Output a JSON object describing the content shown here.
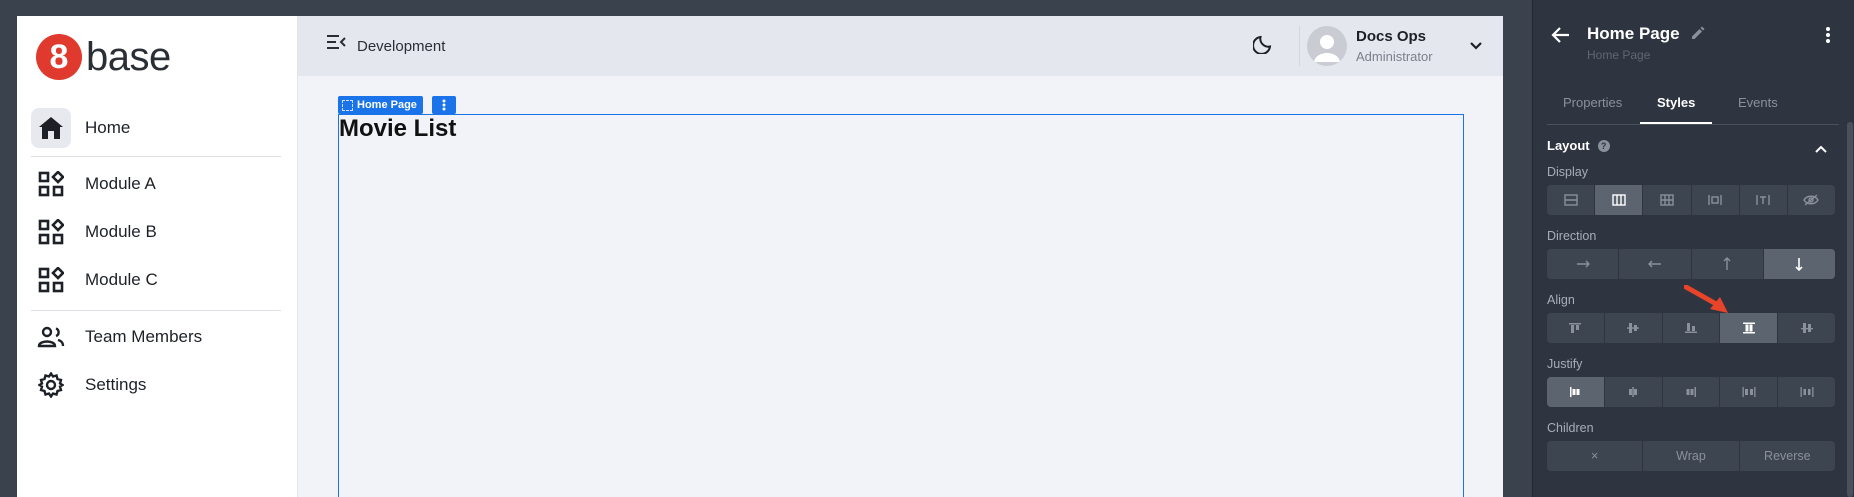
{
  "sidebar": {
    "logo": {
      "mark": "8",
      "text": "base",
      "brand_color": "#e03a2f"
    },
    "items": [
      {
        "label": "Home",
        "icon": "home-icon",
        "active": true
      },
      {
        "label": "Module A",
        "icon": "modules-icon"
      },
      {
        "label": "Module B",
        "icon": "modules-icon"
      },
      {
        "label": "Module C",
        "icon": "modules-icon"
      },
      {
        "label": "Team Members",
        "icon": "team-icon"
      },
      {
        "label": "Settings",
        "icon": "gear-icon"
      }
    ]
  },
  "topbar": {
    "environment": "Development",
    "user": {
      "name": "Docs Ops",
      "role": "Administrator"
    }
  },
  "canvas": {
    "selected_badge": "Home Page",
    "heading": "Movie List",
    "selection_color": "#1a73e8"
  },
  "panel": {
    "title": "Home Page",
    "subtitle": "Home Page",
    "tabs": [
      "Properties",
      "Styles",
      "Events"
    ],
    "active_tab": "Styles",
    "section": "Layout",
    "display": {
      "label": "Display",
      "options": [
        "block",
        "flex",
        "grid",
        "inline-flex",
        "inline",
        "none"
      ],
      "selected": "flex"
    },
    "direction": {
      "label": "Direction",
      "options": [
        "row",
        "row-reverse",
        "column-reverse",
        "column"
      ],
      "selected": "column"
    },
    "align": {
      "label": "Align",
      "options": [
        "start",
        "center",
        "end",
        "stretch",
        "baseline"
      ],
      "selected": "stretch"
    },
    "justify": {
      "label": "Justify",
      "options": [
        "start",
        "center",
        "end",
        "space-between",
        "space-around"
      ],
      "selected": "start"
    },
    "children": {
      "label": "Children",
      "options": [
        "×",
        "Wrap",
        "Reverse"
      ]
    }
  },
  "annotation": {
    "arrow_color": "#e8442a"
  }
}
